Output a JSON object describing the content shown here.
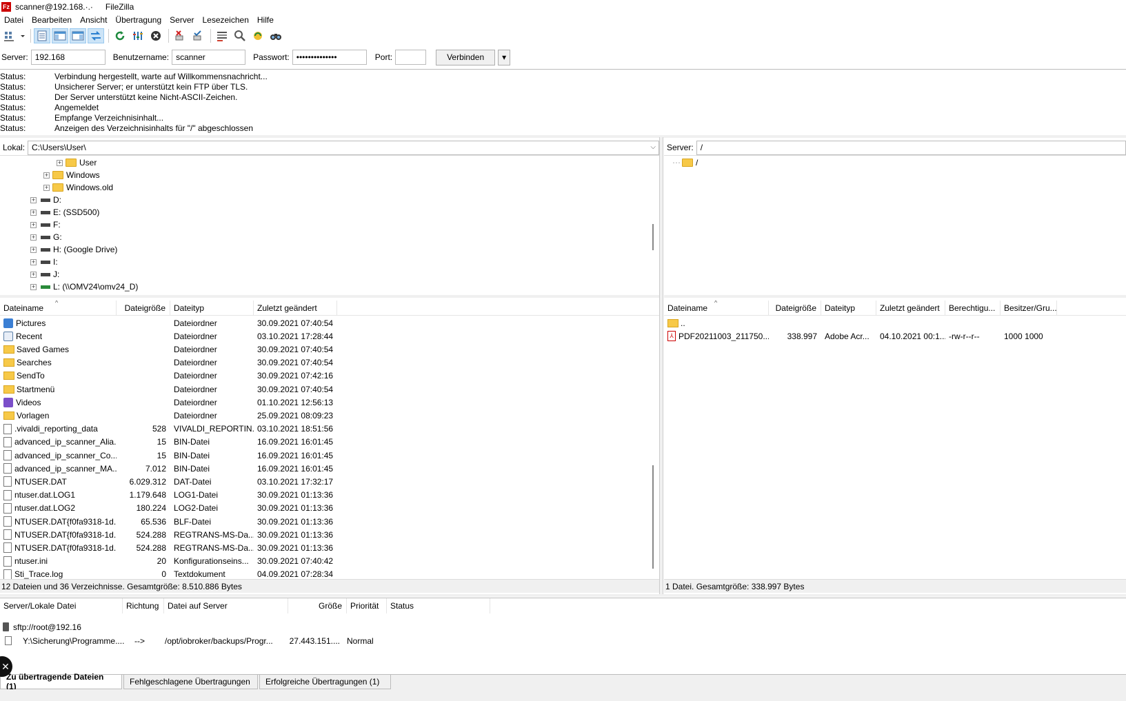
{
  "window": {
    "title": "scanner@192.168.·.·",
    "app_name": "FileZilla",
    "icon_text": "Fz"
  },
  "menu": [
    "Datei",
    "Bearbeiten",
    "Ansicht",
    "Übertragung",
    "Server",
    "Lesezeichen",
    "Hilfe"
  ],
  "toolbar": {
    "icons": [
      "site-manager-icon",
      "dropdown-arrow-icon",
      "toggle-message-log-icon",
      "toggle-local-tree-icon",
      "toggle-remote-tree-icon",
      "toggle-transfer-queue-icon",
      "refresh-icon",
      "process-queue-icon",
      "cancel-icon",
      "disconnect-icon",
      "reconnect-icon",
      "directory-filter-icon",
      "sync-browsing-icon",
      "compare-icon",
      "search-icon"
    ]
  },
  "quickconnect": {
    "server_label": "Server:",
    "server_value": "192.168",
    "user_label": "Benutzername:",
    "user_value": "scanner",
    "password_label": "Passwort:",
    "password_value": "••••••••••••••",
    "port_label": "Port:",
    "port_value": "",
    "connect_label": "Verbinden",
    "dropdown_glyph": "▾"
  },
  "message_log": [
    {
      "type": "Status:",
      "text": "Verbindung hergestellt, warte auf Willkommensnachricht..."
    },
    {
      "type": "Status:",
      "text": "Unsicherer Server; er unterstützt kein FTP über TLS."
    },
    {
      "type": "Status:",
      "text": "Der Server unterstützt keine Nicht-ASCII-Zeichen."
    },
    {
      "type": "Status:",
      "text": "Angemeldet"
    },
    {
      "type": "Status:",
      "text": "Empfange Verzeichnisinhalt..."
    },
    {
      "type": "Status:",
      "text": "Anzeigen des Verzeichnisinhalts für \"/\" abgeschlossen"
    }
  ],
  "local": {
    "path_label": "Lokal:",
    "path_value": "C:\\Users\\User\\",
    "tree": [
      {
        "label": "User",
        "kind": "folder"
      },
      {
        "label": "Windows",
        "kind": "folder"
      },
      {
        "label": "Windows.old",
        "kind": "folder"
      },
      {
        "label": "D:",
        "kind": "drive"
      },
      {
        "label": "E: (SSD500)",
        "kind": "drive"
      },
      {
        "label": "F:",
        "kind": "drive"
      },
      {
        "label": "G:",
        "kind": "drive"
      },
      {
        "label": "H: (Google Drive)",
        "kind": "drive"
      },
      {
        "label": "I:",
        "kind": "drive"
      },
      {
        "label": "J:",
        "kind": "drive"
      },
      {
        "label": "L: (\\\\OMV24\\omv24_D)",
        "kind": "netdrive"
      }
    ],
    "columns": [
      "Dateiname",
      "Dateigröße",
      "Dateityp",
      "Zuletzt geändert"
    ],
    "files": [
      {
        "name": "Pictures",
        "size": "",
        "type": "Dateiordner",
        "modified": "30.09.2021 07:40:54",
        "icon": "pictures"
      },
      {
        "name": "Recent",
        "size": "",
        "type": "Dateiordner",
        "modified": "03.10.2021 17:28:44",
        "icon": "recent"
      },
      {
        "name": "Saved Games",
        "size": "",
        "type": "Dateiordner",
        "modified": "30.09.2021 07:40:54",
        "icon": "folder"
      },
      {
        "name": "Searches",
        "size": "",
        "type": "Dateiordner",
        "modified": "30.09.2021 07:40:54",
        "icon": "folder"
      },
      {
        "name": "SendTo",
        "size": "",
        "type": "Dateiordner",
        "modified": "30.09.2021 07:42:16",
        "icon": "folder"
      },
      {
        "name": "Startmenü",
        "size": "",
        "type": "Dateiordner",
        "modified": "30.09.2021 07:40:54",
        "icon": "folder"
      },
      {
        "name": "Videos",
        "size": "",
        "type": "Dateiordner",
        "modified": "01.10.2021 12:56:13",
        "icon": "videos"
      },
      {
        "name": "Vorlagen",
        "size": "",
        "type": "Dateiordner",
        "modified": "25.09.2021 08:09:23",
        "icon": "folder"
      },
      {
        "name": ".vivaldi_reporting_data",
        "size": "528",
        "type": "VIVALDI_REPORTIN...",
        "modified": "03.10.2021 18:51:56",
        "icon": "file"
      },
      {
        "name": "advanced_ip_scanner_Alia...",
        "size": "15",
        "type": "BIN-Datei",
        "modified": "16.09.2021 16:01:45",
        "icon": "file"
      },
      {
        "name": "advanced_ip_scanner_Co...",
        "size": "15",
        "type": "BIN-Datei",
        "modified": "16.09.2021 16:01:45",
        "icon": "file"
      },
      {
        "name": "advanced_ip_scanner_MA...",
        "size": "7.012",
        "type": "BIN-Datei",
        "modified": "16.09.2021 16:01:45",
        "icon": "file"
      },
      {
        "name": "NTUSER.DAT",
        "size": "6.029.312",
        "type": "DAT-Datei",
        "modified": "03.10.2021 17:32:17",
        "icon": "file"
      },
      {
        "name": "ntuser.dat.LOG1",
        "size": "1.179.648",
        "type": "LOG1-Datei",
        "modified": "30.09.2021 01:13:36",
        "icon": "file"
      },
      {
        "name": "ntuser.dat.LOG2",
        "size": "180.224",
        "type": "LOG2-Datei",
        "modified": "30.09.2021 01:13:36",
        "icon": "file"
      },
      {
        "name": "NTUSER.DAT{f0fa9318-1d...",
        "size": "65.536",
        "type": "BLF-Datei",
        "modified": "30.09.2021 01:13:36",
        "icon": "file"
      },
      {
        "name": "NTUSER.DAT{f0fa9318-1d...",
        "size": "524.288",
        "type": "REGTRANS-MS-Da...",
        "modified": "30.09.2021 01:13:36",
        "icon": "file"
      },
      {
        "name": "NTUSER.DAT{f0fa9318-1d...",
        "size": "524.288",
        "type": "REGTRANS-MS-Da...",
        "modified": "30.09.2021 01:13:36",
        "icon": "file"
      },
      {
        "name": "ntuser.ini",
        "size": "20",
        "type": "Konfigurationseins...",
        "modified": "30.09.2021 07:40:42",
        "icon": "file"
      },
      {
        "name": "Sti_Trace.log",
        "size": "0",
        "type": "Textdokument",
        "modified": "04.09.2021 07:28:34",
        "icon": "file"
      }
    ],
    "status": "12 Dateien und 36 Verzeichnisse. Gesamtgröße: 8.510.886 Bytes"
  },
  "remote": {
    "path_label": "Server:",
    "path_value": "/",
    "tree": [
      {
        "label": "/",
        "kind": "folder"
      }
    ],
    "columns": [
      "Dateiname",
      "Dateigröße",
      "Dateityp",
      "Zuletzt geändert",
      "Berechtigu...",
      "Besitzer/Gru..."
    ],
    "files": [
      {
        "name": "..",
        "size": "",
        "type": "",
        "modified": "",
        "perm": "",
        "owner": "",
        "icon": "folder"
      },
      {
        "name": "PDF20211003_211750....",
        "size": "338.997",
        "type": "Adobe Acr...",
        "modified": "04.10.2021 00:1...",
        "perm": "-rw-r--r--",
        "owner": "1000 1000",
        "icon": "pdf"
      }
    ],
    "status": "1 Datei. Gesamtgröße: 338.997 Bytes"
  },
  "queue": {
    "columns": [
      "Server/Lokale Datei",
      "Richtung",
      "Datei auf Server",
      "Größe",
      "Priorität",
      "Status"
    ],
    "server_row": "sftp://root@192.16",
    "rows": [
      {
        "local": "Y:\\Sicherung\\Programme....",
        "direction": "-->",
        "remote": "/opt/iobroker/backups/Progr...",
        "size": "27.443.151....",
        "priority": "Normal",
        "status": ""
      }
    ]
  },
  "tabs": [
    "Zu übertragende Dateien (1)",
    "Fehlgeschlagene Übertragungen",
    "Erfolgreiche Übertragungen (1)"
  ],
  "overlay": {
    "glyph": "✕"
  }
}
